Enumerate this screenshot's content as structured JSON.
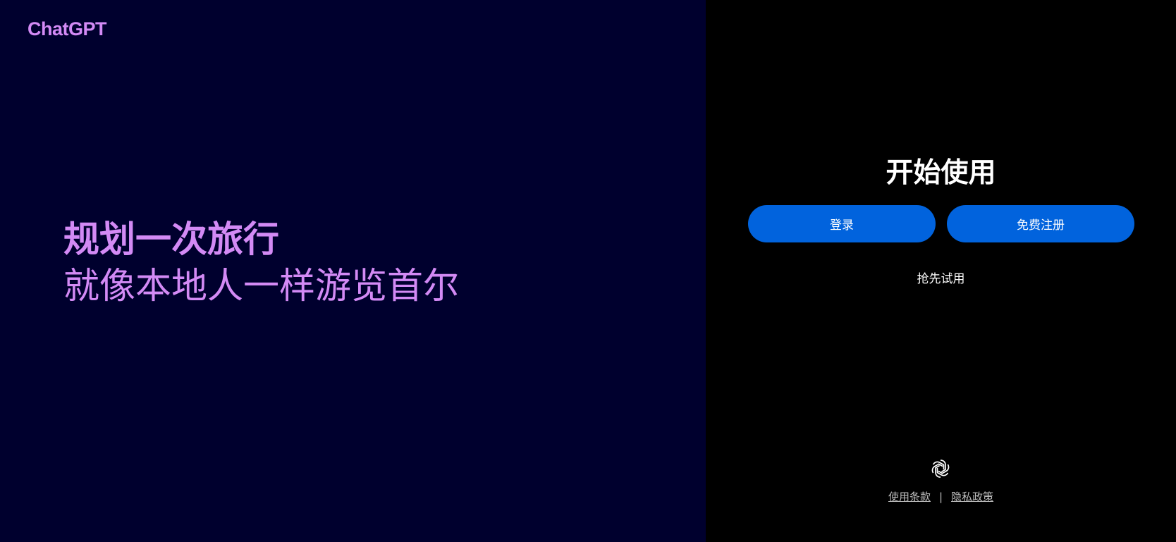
{
  "brand": {
    "name": "ChatGPT",
    "color": "#d38af5"
  },
  "hero": {
    "line1": "规划一次旅行",
    "line2": "就像本地人一样游览首尔"
  },
  "auth": {
    "title": "开始使用",
    "login_label": "登录",
    "signup_label": "免费注册",
    "try_label": "抢先试用",
    "button_color": "#0163dd"
  },
  "footer": {
    "logo_icon": "openai-logo-icon",
    "terms_label": "使用条款",
    "separator": "|",
    "privacy_label": "隐私政策"
  },
  "colors": {
    "left_bg": "#00002e",
    "right_bg": "#000000"
  }
}
